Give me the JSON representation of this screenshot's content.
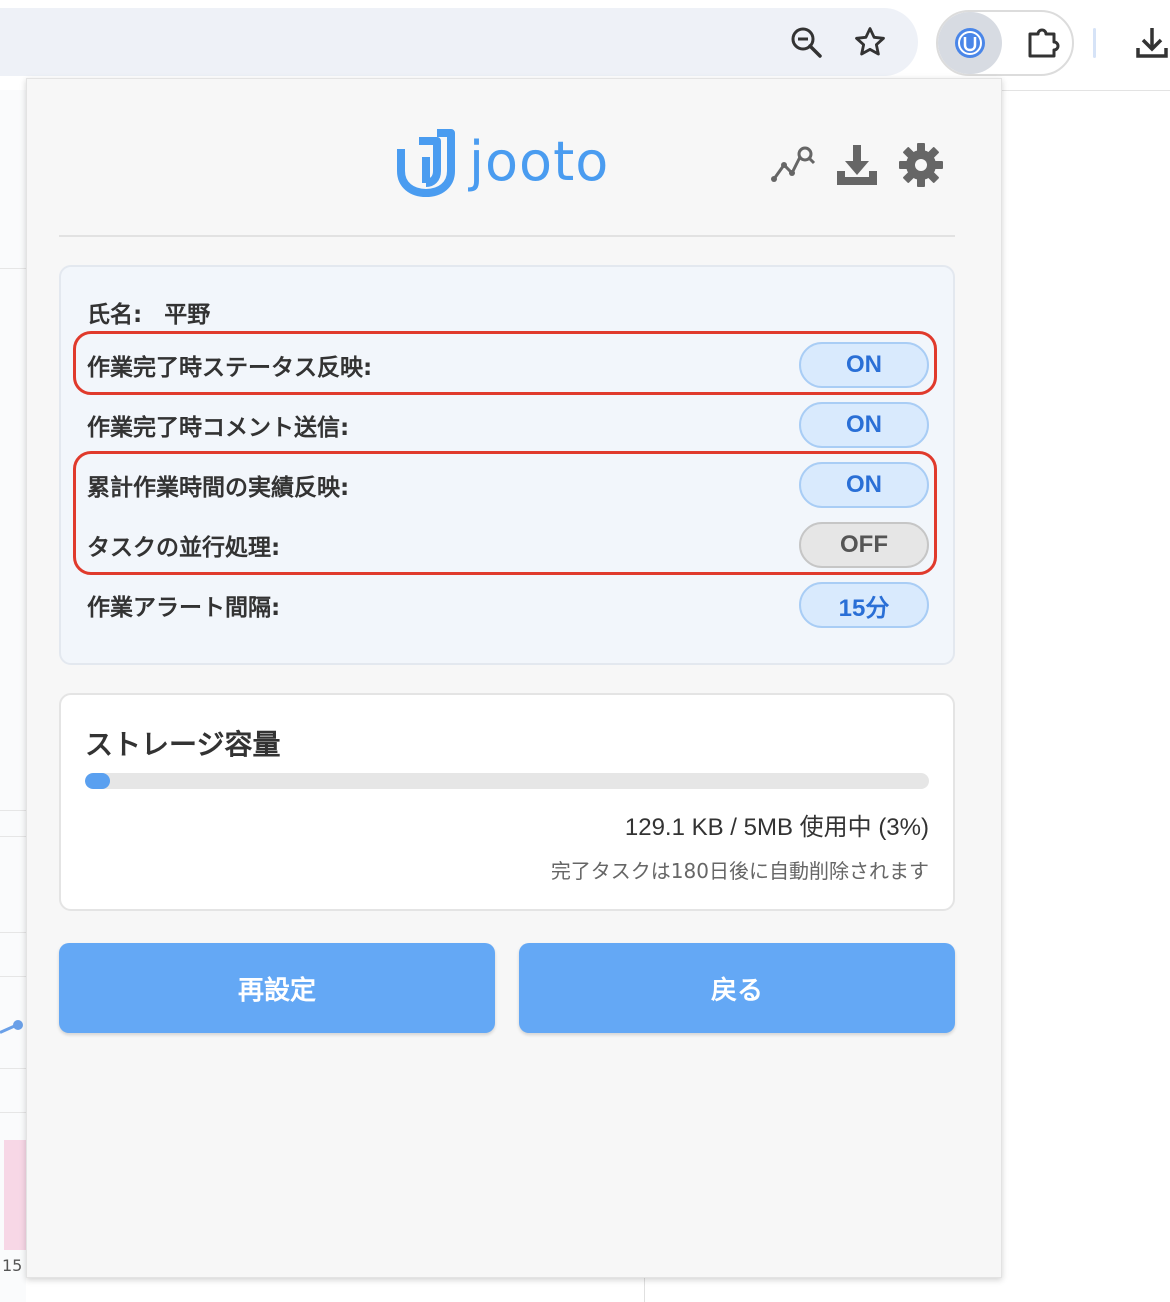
{
  "browser": {
    "icons": [
      "zoom-out-icon",
      "star-icon",
      "jooto-extension-icon",
      "puzzle-icon",
      "download-icon"
    ]
  },
  "background": {
    "tick_label": "15"
  },
  "popup": {
    "logo_text": "jooto",
    "header_icons": [
      "chart-search-icon",
      "download-icon",
      "gear-icon"
    ],
    "name_label": "氏名:",
    "name_value": "平野",
    "settings": [
      {
        "label": "作業完了時ステータス反映:",
        "value": "ON",
        "state": "on"
      },
      {
        "label": "作業完了時コメント送信:",
        "value": "ON",
        "state": "on"
      },
      {
        "label": "累計作業時間の実績反映:",
        "value": "ON",
        "state": "on"
      },
      {
        "label": "タスクの並行処理:",
        "value": "OFF",
        "state": "off"
      },
      {
        "label": "作業アラート間隔:",
        "value": "15分",
        "state": "on"
      }
    ],
    "storage": {
      "title": "ストレージ容量",
      "usage_text": "129.1 KB / 5MB 使用中 (3%)",
      "usage_percent": 3,
      "note": "完了タスクは180日後に自動削除されます"
    },
    "buttons": {
      "reset": "再設定",
      "back": "戻る"
    },
    "colors": {
      "accent": "#64a8f5",
      "highlight": "#e03a2c",
      "pill_on_text": "#2a6fd6"
    }
  }
}
